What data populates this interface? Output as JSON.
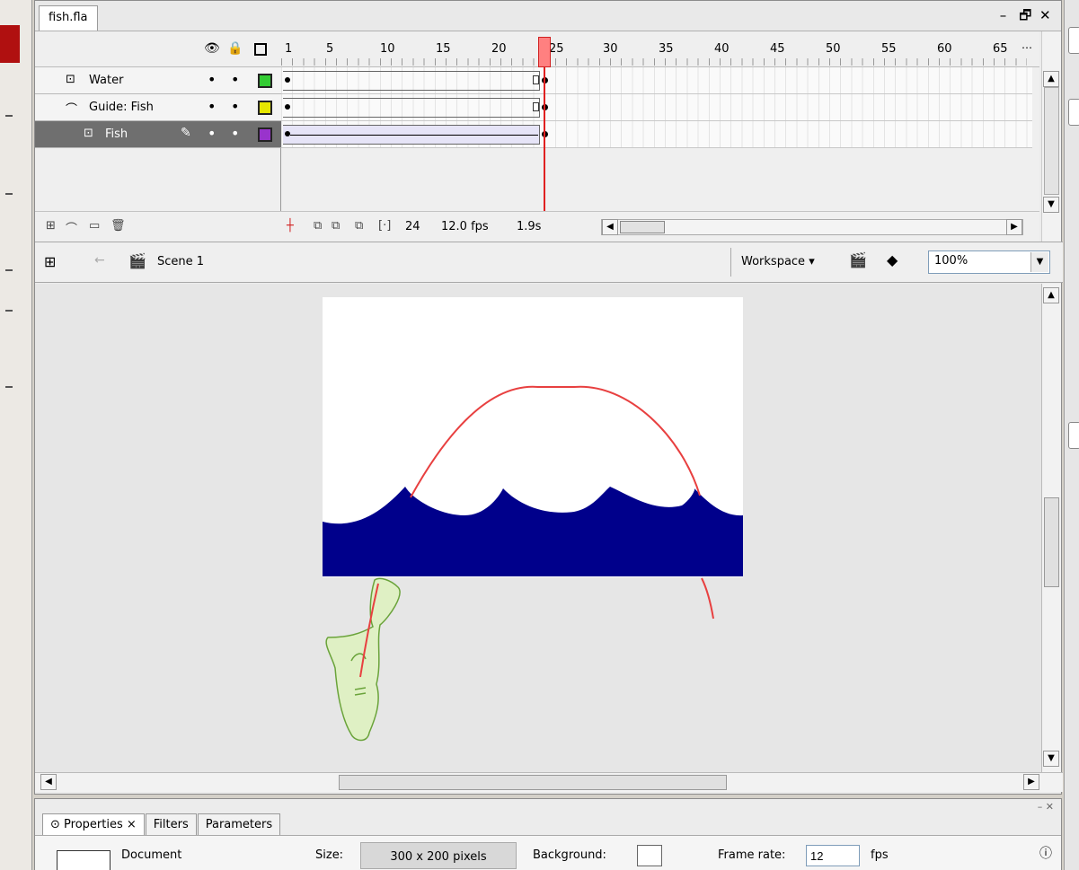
{
  "document": {
    "tab_title": "fish.fla",
    "window_controls": [
      "–",
      "🗗",
      "✕"
    ]
  },
  "timeline": {
    "frame_numbers": [
      "1",
      "5",
      "10",
      "15",
      "20",
      "25",
      "30",
      "35",
      "40",
      "45",
      "50",
      "55",
      "60",
      "65"
    ],
    "current_frame_marker": 24,
    "layers": [
      {
        "name": "Water",
        "type": "normal",
        "swatch_color": "#33cc33",
        "selected": false
      },
      {
        "name": "Guide: Fish",
        "type": "guide",
        "swatch_color": "#e6e600",
        "selected": false
      },
      {
        "name": "Fish",
        "type": "guided",
        "swatch_color": "#9933cc",
        "selected": true
      }
    ],
    "footer": {
      "current_frame": "24",
      "frame_rate": "12.0 fps",
      "elapsed": "1.9s"
    }
  },
  "edit_bar": {
    "scene_label": "Scene 1",
    "workspace_label": "Workspace ▾",
    "zoom": "100%"
  },
  "stage": {
    "background_color": "#ffffff",
    "water_color": "#00008b",
    "guide_path_color": "#e84040",
    "fish_fill_color": "#dff0c4",
    "fish_outline_color": "#6aa33a"
  },
  "properties": {
    "tabs": [
      "Properties ×",
      "Filters",
      "Parameters"
    ],
    "doc_label": "Document",
    "size_label": "Size:",
    "size_value": "300 x 200 pixels",
    "background_label": "Background:",
    "frame_rate_label": "Frame rate:",
    "frame_rate_value": "12",
    "fps_unit": "fps"
  },
  "icons": {
    "eye": "eye-icon",
    "lock": "lock-icon",
    "outline": "outline-icon",
    "pencil": "pencil-icon",
    "help": "help-icon"
  }
}
